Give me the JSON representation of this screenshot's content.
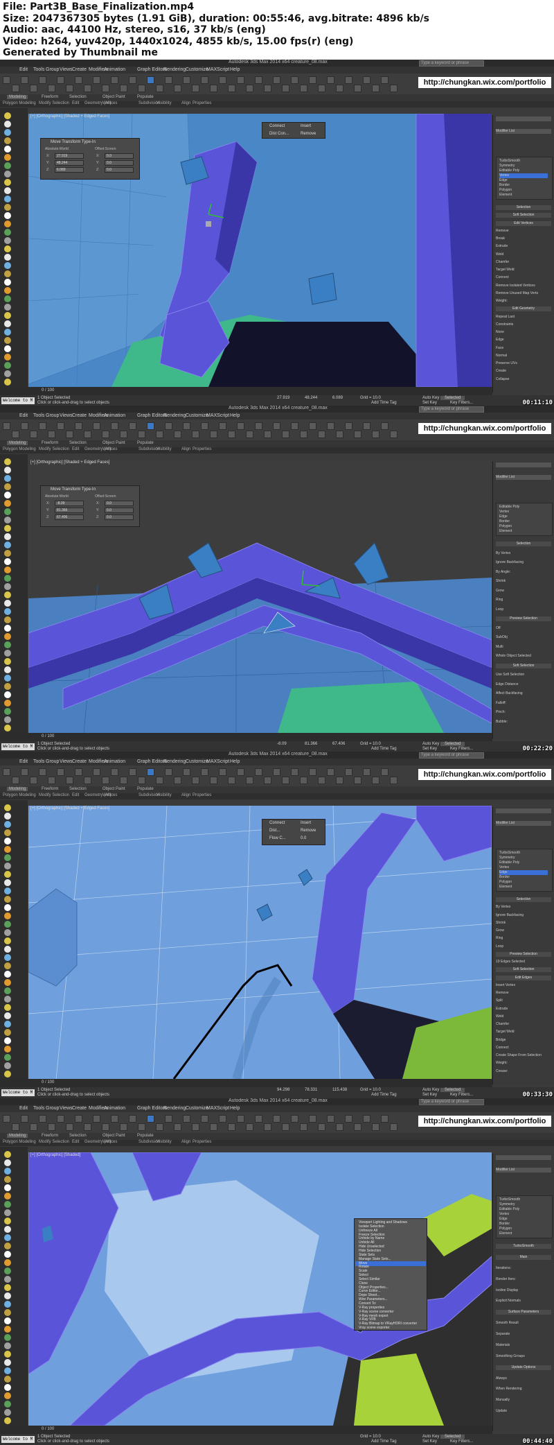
{
  "header": {
    "file": "File: Part3B_Base_Finalization.mp4",
    "size": "Size: 2047367305 bytes (1.91 GiB), duration: 00:55:46, avg.bitrate: 4896 kb/s",
    "audio": "Audio: aac, 44100 Hz, stereo, s16, 37 kb/s (eng)",
    "video": "Video: h264, yuv420p, 1440x1024, 4855 kb/s, 15.00 fps(r) (eng)",
    "generated": "Generated by Thumbnail me"
  },
  "app": {
    "title": "Autodesk 3ds Max 2014 x64    creature_08.max",
    "search_placeholder": "Type a keyword or phrase",
    "url": "http://chungkan.wix.com/portfolio",
    "workspace": "Workspace: Default",
    "menus": [
      "Edit",
      "Tools",
      "Group",
      "Views",
      "Create",
      "Modifiers",
      "Animation",
      "Graph Editors",
      "Rendering",
      "Customize",
      "MAXScript",
      "Help"
    ],
    "ribbon_tabs": [
      "Modeling",
      "Freeform",
      "Selection",
      "Object Paint",
      "Populate"
    ],
    "ribbon_sub": [
      "Polygon Modeling",
      "Modify Selection",
      "Edit",
      "Geometry (All)",
      "Vertices",
      "Subdivision",
      "Visibility",
      "Align",
      "Properties"
    ],
    "welcome": "Welcome to M",
    "status_selected": "1 Object Selected",
    "status_hint": "Click or click-and-drag to select objects",
    "add_time_tag": "Add Time Tag",
    "auto_key": "Auto Key",
    "set_key": "Set Key",
    "key_filters": "Key Filters...",
    "selected_label": "Selected",
    "frame_counter": "0 / 100"
  },
  "frames": [
    {
      "viewport_label": "[+] [Orthographic] [Shaded + Edged Faces]",
      "dialog_title": "Move Transform Type-In",
      "abs_label": "Absolute:World",
      "off_label": "Offset:Screen",
      "x": "27.919",
      "y": "48.244",
      "z": "6.089",
      "ox": "0.0",
      "oy": "0.0",
      "oz": "0.0",
      "caddy": [
        "Connect",
        "Insert",
        "Dist Con...",
        "Remove"
      ],
      "modifier_list": [
        "TurboSmooth",
        "Symmetry",
        "Editable Poly",
        "Vertex",
        "Edge",
        "Border",
        "Polygon",
        "Element"
      ],
      "panel_items": [
        "Selection",
        "Soft Selection",
        "Edit Vertices",
        "Remove",
        "Break",
        "Extrude",
        "Weld",
        "Chamfer",
        "Target Weld",
        "Connect",
        "Remove Isolated Vertices",
        "Remove Unused Map Verts",
        "Weight:",
        "Edit Geometry",
        "Repeat Last",
        "Constraints",
        "None",
        "Edge",
        "Face",
        "Normal",
        "Preserve UVs",
        "Create",
        "Collapse"
      ],
      "status_x": "27.919",
      "status_y": "48.244",
      "status_z": "6.089",
      "grid": "Grid = 10.0",
      "timestamp": "00:11:10"
    },
    {
      "viewport_label": "[+] [Orthographic] [Shaded + Edged Faces]",
      "dialog_title": "Move Transform Type-In",
      "abs_label": "Absolute:World",
      "off_label": "Offset:Screen",
      "x": "-8.09",
      "y": "81.366",
      "z": "67.406",
      "ox": "0.0",
      "oy": "0.0",
      "oz": "0.0",
      "caddy": [],
      "modifier_list": [
        "Editable Poly",
        "Vertex",
        "Edge",
        "Border",
        "Polygon",
        "Element"
      ],
      "panel_items": [
        "Selection",
        "By Vertex",
        "Ignore Backfacing",
        "By Angle:",
        "Shrink",
        "Grow",
        "Ring",
        "Loop",
        "Preview Selection",
        "Off",
        "SubObj",
        "Multi",
        "Whole Object Selected",
        "Soft Selection",
        "Use Soft Selection",
        "Edge Distance",
        "Affect Backfacing",
        "Falloff:",
        "Pinch:",
        "Bubble:"
      ],
      "status_x": "-8.09",
      "status_y": "81.366",
      "status_z": "67.406",
      "grid": "Grid = 10.0",
      "timestamp": "00:22:20"
    },
    {
      "viewport_label": "[+] [Orthographic] [Shaded + Edged Faces]",
      "dialog_title": "",
      "abs_label": "",
      "off_label": "",
      "x": "",
      "y": "",
      "z": "",
      "ox": "",
      "oy": "",
      "oz": "",
      "caddy": [
        "Connect",
        "Insert",
        "Dist...",
        "Remove",
        "Flow C...",
        "0.0"
      ],
      "modifier_list": [
        "TurboSmooth",
        "Symmetry",
        "Editable Poly",
        "Vertex",
        "Edge",
        "Border",
        "Polygon",
        "Element"
      ],
      "panel_items": [
        "Selection",
        "By Vertex",
        "Ignore Backfacing",
        "Shrink",
        "Grow",
        "Ring",
        "Loop",
        "Preview Selection",
        "19 Edges Selected",
        "Soft Selection",
        "Edit Edges",
        "Insert Vertex",
        "Remove",
        "Split",
        "Extrude",
        "Weld",
        "Chamfer",
        "Target Weld",
        "Bridge",
        "Connect",
        "Create Shape From Selection",
        "Weight:",
        "Crease:"
      ],
      "status_x": "94.298",
      "status_y": "78.331",
      "status_z": "115.438",
      "grid": "Grid = 10.0",
      "timestamp": "00:33:30"
    },
    {
      "viewport_label": "[+] [Orthographic] [Shaded]",
      "dialog_title": "",
      "abs_label": "",
      "off_label": "",
      "x": "",
      "y": "",
      "z": "",
      "ox": "",
      "oy": "",
      "oz": "",
      "caddy": [],
      "modifier_list": [
        "TurboSmooth",
        "Symmetry",
        "Editable Poly",
        "Vertex",
        "Edge",
        "Border",
        "Polygon",
        "Element"
      ],
      "panel_items": [
        "TurboSmooth",
        "Main",
        "Iterations:",
        "Render Iters:",
        "Isoline Display",
        "Explicit Normals",
        "Surface Parameters",
        "Smooth Result",
        "Separate",
        "Materials",
        "Smoothing Groups",
        "Update Options",
        "Always",
        "When Rendering",
        "Manually",
        "Update"
      ],
      "status_x": "",
      "status_y": "",
      "status_z": "",
      "grid": "Grid = 10.0",
      "timestamp": "00:44:40",
      "context_menu": [
        "Viewport Lighting and Shadows",
        "Isolate Selection",
        "Unfreeze All",
        "Freeze Selection",
        "Unhide by Name",
        "Unhide All",
        "Hide Unselected",
        "Hide Selection",
        "State Sets",
        "Manage State Sets...",
        "Move",
        "Rotate",
        "Scale",
        "Select",
        "Select Similar",
        "Clone",
        "Object Properties...",
        "Curve Editor...",
        "Dope Sheet...",
        "Wire Parameters...",
        "Convert To:",
        "V-Ray properties",
        "V-Ray scene converter",
        "V-Ray mesh export",
        "V-Ray VFB",
        "V-Ray Bitmap to VRayHDRI converter",
        "Vray scene exporter"
      ]
    }
  ],
  "colors": {
    "bg_dark": "#3b3b3b",
    "viewport_blue": "#6f9fdc",
    "mesh_purple": "#5a55d8",
    "mesh_green": "#3fb98a",
    "lime": "#a8d23a"
  }
}
